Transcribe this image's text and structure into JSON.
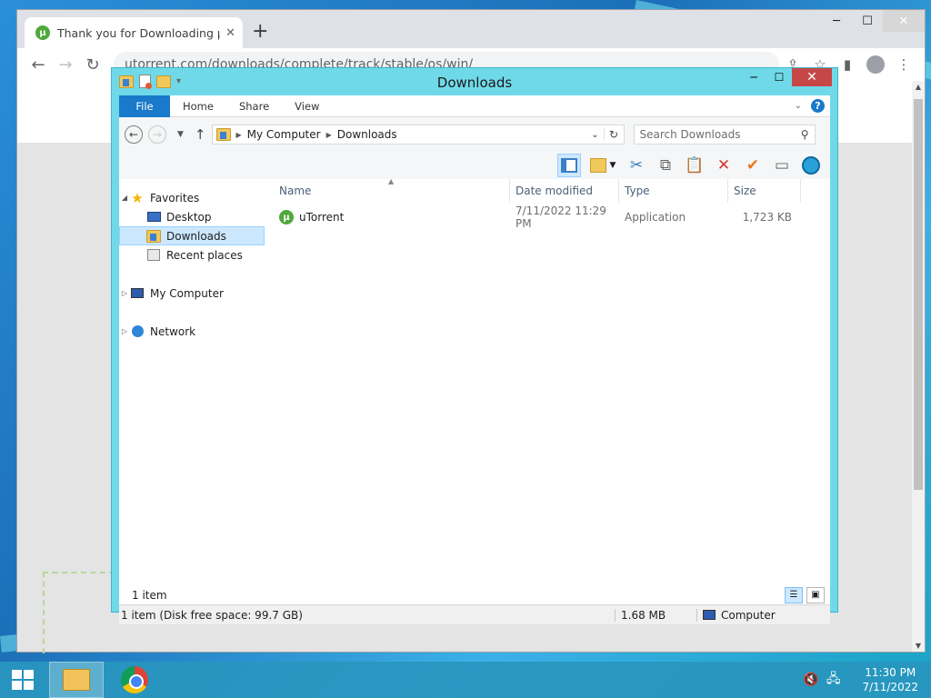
{
  "browser": {
    "tab_title": "Thank you for Downloading µTor",
    "tab_close": "✕",
    "new_tab": "+",
    "url": "utorrent.com/downloads/complete/track/stable/os/win/"
  },
  "explorer": {
    "title": "Downloads",
    "ribbon": {
      "file": "File",
      "home": "Home",
      "share": "Share",
      "view": "View"
    },
    "breadcrumb": [
      "My Computer",
      "Downloads"
    ],
    "search_placeholder": "Search Downloads",
    "nav": {
      "favorites": "Favorites",
      "desktop": "Desktop",
      "downloads": "Downloads",
      "recent": "Recent places",
      "computer": "My Computer",
      "network": "Network"
    },
    "columns": {
      "name": "Name",
      "date": "Date modified",
      "type": "Type",
      "size": "Size"
    },
    "files": [
      {
        "name": "uTorrent",
        "date": "7/11/2022 11:29 PM",
        "type": "Application",
        "size": "1,723 KB"
      }
    ],
    "item_count": "1 item",
    "status": {
      "info": "1 item (Disk free space: 99.7 GB)",
      "size": "1.68 MB",
      "location": "Computer"
    }
  },
  "taskbar": {
    "time": "11:30 PM",
    "date": "7/11/2022"
  },
  "colors": {
    "explorer_frame": "#6fd9e9",
    "ribbon_file": "#1979ca",
    "close_button": "#c74747",
    "selection": "#cce8ff"
  }
}
